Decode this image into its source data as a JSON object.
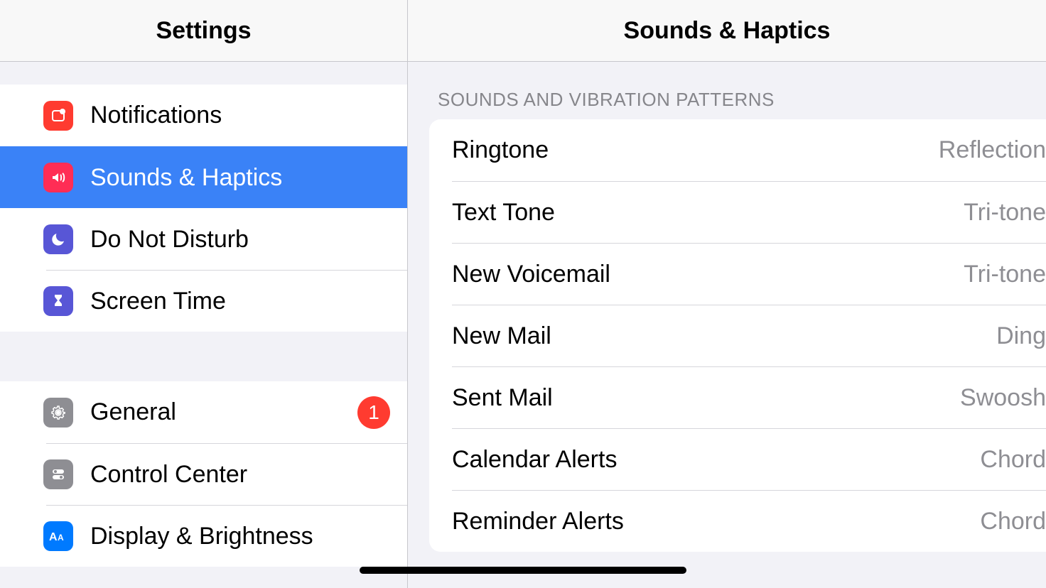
{
  "sidebar": {
    "title": "Settings",
    "groups": [
      {
        "items": [
          {
            "id": "notifications",
            "label": "Notifications",
            "icon": "notifications-icon",
            "icon_bg": "bg-red"
          },
          {
            "id": "sounds-haptics",
            "label": "Sounds & Haptics",
            "icon": "sounds-icon",
            "icon_bg": "bg-pink",
            "selected": true
          },
          {
            "id": "do-not-disturb",
            "label": "Do Not Disturb",
            "icon": "moon-icon",
            "icon_bg": "bg-purple"
          },
          {
            "id": "screen-time",
            "label": "Screen Time",
            "icon": "hourglass-icon",
            "icon_bg": "bg-purple"
          }
        ]
      },
      {
        "items": [
          {
            "id": "general",
            "label": "General",
            "icon": "gear-icon",
            "icon_bg": "bg-gray",
            "badge": "1"
          },
          {
            "id": "control-center",
            "label": "Control Center",
            "icon": "toggles-icon",
            "icon_bg": "bg-gray"
          },
          {
            "id": "display-brightness",
            "label": "Display & Brightness",
            "icon": "text-size-icon",
            "icon_bg": "bg-blue"
          }
        ]
      }
    ]
  },
  "detail": {
    "title": "Sounds & Haptics",
    "section_header": "SOUNDS AND VIBRATION PATTERNS",
    "items": [
      {
        "id": "ringtone",
        "label": "Ringtone",
        "value": "Reflection"
      },
      {
        "id": "text-tone",
        "label": "Text Tone",
        "value": "Tri-tone"
      },
      {
        "id": "new-voicemail",
        "label": "New Voicemail",
        "value": "Tri-tone"
      },
      {
        "id": "new-mail",
        "label": "New Mail",
        "value": "Ding"
      },
      {
        "id": "sent-mail",
        "label": "Sent Mail",
        "value": "Swoosh"
      },
      {
        "id": "calendar-alerts",
        "label": "Calendar Alerts",
        "value": "Chord"
      },
      {
        "id": "reminder-alerts",
        "label": "Reminder Alerts",
        "value": "Chord"
      }
    ]
  }
}
